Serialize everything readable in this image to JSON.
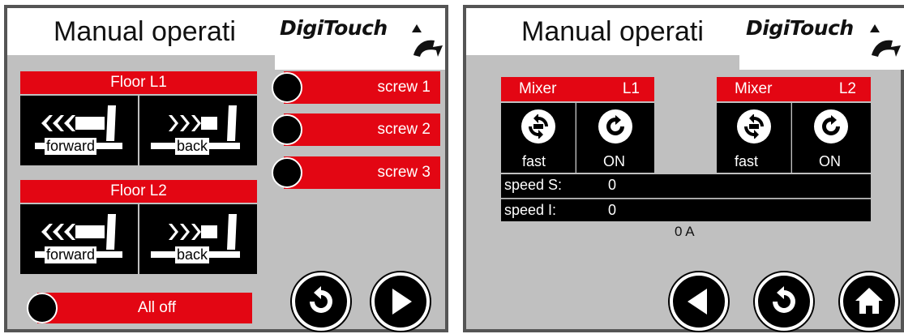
{
  "left": {
    "title": "Manual operati",
    "logo": "DigiTouch",
    "floor1": {
      "label": "Floor L1",
      "forward": "forward",
      "back": "back"
    },
    "floor2": {
      "label": "Floor L2",
      "forward": "forward",
      "back": "back"
    },
    "screws": [
      "screw 1",
      "screw 2",
      "screw 3"
    ],
    "all_off": "All off",
    "nav_icons": [
      "undo-icon",
      "play-icon"
    ]
  },
  "right": {
    "title": "Manual operati",
    "logo": "DigiTouch",
    "mixer1": {
      "name": "Mixer",
      "level": "L1",
      "speed_mode": "fast",
      "state": "ON"
    },
    "mixer2": {
      "name": "Mixer",
      "level": "L2",
      "speed_mode": "fast",
      "state": "ON"
    },
    "speed_s_label": "speed S:",
    "speed_s_value": "0",
    "speed_i_label": "speed I:",
    "speed_i_value": "0",
    "current": "0 A",
    "nav_icons": [
      "back-icon",
      "undo-icon",
      "home-icon"
    ]
  },
  "colors": {
    "panel": "#c0c0c0",
    "red": "#e30613",
    "black": "#000000",
    "frame": "#555555"
  }
}
